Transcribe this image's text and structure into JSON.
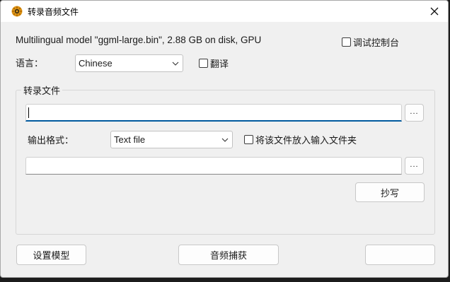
{
  "window": {
    "title": "转录音频文件",
    "close_glyph": "✕"
  },
  "model_info": "Multilingual model \"ggml-large.bin\", 2.88 GB on disk, GPU",
  "debug_console": {
    "label": "调试控制台",
    "checked": false
  },
  "language": {
    "label": "语言：",
    "value": "Chinese"
  },
  "translate": {
    "label": "翻译",
    "checked": false
  },
  "transcribe_group": {
    "label": "转录文件",
    "input_value": "",
    "browse_label": "...",
    "output_format_label": "输出格式：",
    "output_format_value": "Text file",
    "place_in_input_folder": {
      "label": "将该文件放入输入文件夹",
      "checked": false
    },
    "output_value": "",
    "output_browse_label": "...",
    "transcribe_button": "抄写"
  },
  "bottom": {
    "setup_model_button": "设置模型",
    "audio_capture_button": "音频捕获"
  },
  "colors": {
    "focus_accent": "#005a9e",
    "background": "#f0f0f0",
    "titlebar": "#ffffff"
  }
}
